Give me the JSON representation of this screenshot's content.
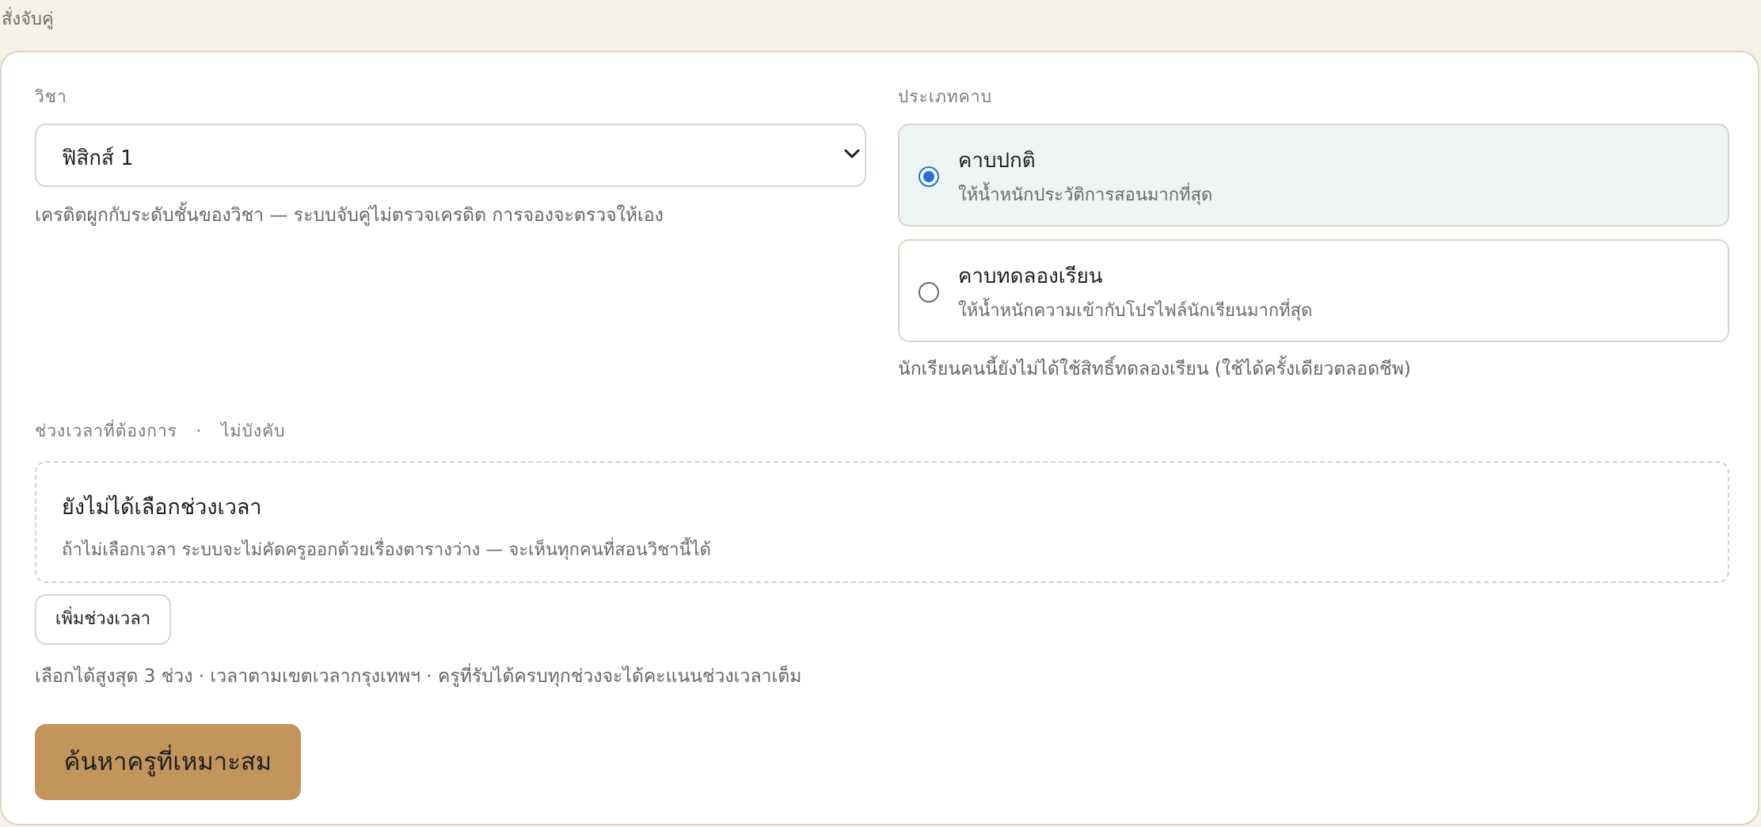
{
  "page": {
    "top_label": "สั่งจับคู่"
  },
  "subject": {
    "label": "วิชา",
    "selected": "ฟิสิกส์ 1",
    "help": "เครดิตผูกกับระดับชั้นของวิชา — ระบบจับคู่ไม่ตรวจเครดิต การจองจะตรวจให้เอง"
  },
  "lesson_type": {
    "label": "ประเภทคาบ",
    "options": [
      {
        "title": "คาบปกติ",
        "desc": "ให้น้ำหนักประวัติการสอนมากที่สุด",
        "selected": true
      },
      {
        "title": "คาบทดลองเรียน",
        "desc": "ให้น้ำหนักความเข้ากับโปรไฟล์นักเรียนมากที่สุด",
        "selected": false
      }
    ],
    "note": "นักเรียนคนนี้ยังไม่ได้ใช้สิทธิ์ทดลองเรียน (ใช้ได้ครั้งเดียวตลอดชีพ)"
  },
  "time_slots": {
    "label": "ช่วงเวลาที่ต้องการ",
    "optional": "ไม่บังคับ",
    "separator": "·",
    "empty_title": "ยังไม่ได้เลือกช่วงเวลา",
    "empty_desc": "ถ้าไม่เลือกเวลา ระบบจะไม่คัดครูออกด้วยเรื่องตารางว่าง — จะเห็นทุกคนที่สอนวิชานี้ได้",
    "add_button": "เพิ่มช่วงเวลา",
    "help": "เลือกได้สูงสุด 3 ช่วง · เวลาตามเขตเวลากรุงเทพฯ · ครูที่รับได้ครบทุกช่วงจะได้คะแนนช่วงเวลาเต็ม"
  },
  "actions": {
    "search": "ค้นหาครูที่เหมาะสม"
  },
  "icons": {
    "chevron": "chevron-down-icon",
    "radio": "radio-icon"
  },
  "colors": {
    "background": "#f5f1e8",
    "card_border": "#ddd4c3",
    "selected_bg": "#eef4f1",
    "accent": "#1f6fe5",
    "primary_button": "#c1955b"
  }
}
